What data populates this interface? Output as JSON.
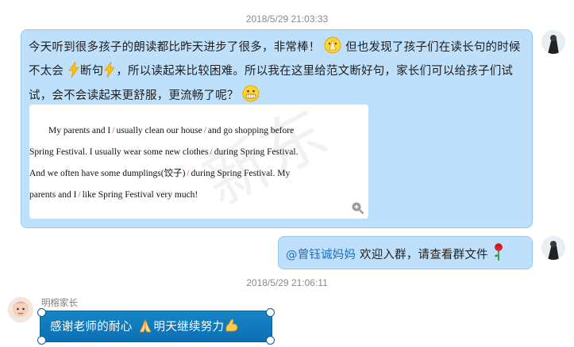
{
  "messages": [
    {
      "timestamp": "2018/5/29 21:03:33",
      "text_segments": [
        "今天听到很多孩子的朗读都比昨天进步了很多，非常棒！",
        "但也发现了孩子们在读长句的时候不太会",
        "断句",
        "，所以读起来比较困难。所以我在这里给范文断好句，家长们可以给孩子们试试，会不会读起来更舒服，更流畅了呢？"
      ],
      "image": {
        "watermark": "新东方",
        "lines": [
          [
            "My parents and I",
            "usually clean our house",
            "and go shopping before"
          ],
          [
            "Spring Festival. I usually wear some new clothes",
            "during Spring Festival."
          ],
          [
            "And we often have some dumplings(饺子)",
            "during Spring Festival. My"
          ],
          [
            "parents and I",
            "like Spring Festival very much!"
          ]
        ]
      }
    },
    {
      "mention": "@曾钰诚妈妈",
      "text": "欢迎入群，请查看群文件"
    },
    {
      "timestamp": "2018/5/29 21:06:11",
      "sender": "明榕家长",
      "text_segments": [
        "感谢老师的耐心",
        "明天继续努力"
      ]
    }
  ],
  "colors": {
    "bubble_blue": "#bfe0fb",
    "bubble_border": "#95c8f0",
    "mention": "#1c6fc4",
    "slash": "#e03a3a",
    "special_bubble": "#1585c5"
  },
  "icons": [
    "pray-icon",
    "lightning-icon",
    "grin-emoji-icon",
    "zoom-in-icon",
    "rose-icon",
    "palms-together-icon",
    "flexed-biceps-icon"
  ]
}
